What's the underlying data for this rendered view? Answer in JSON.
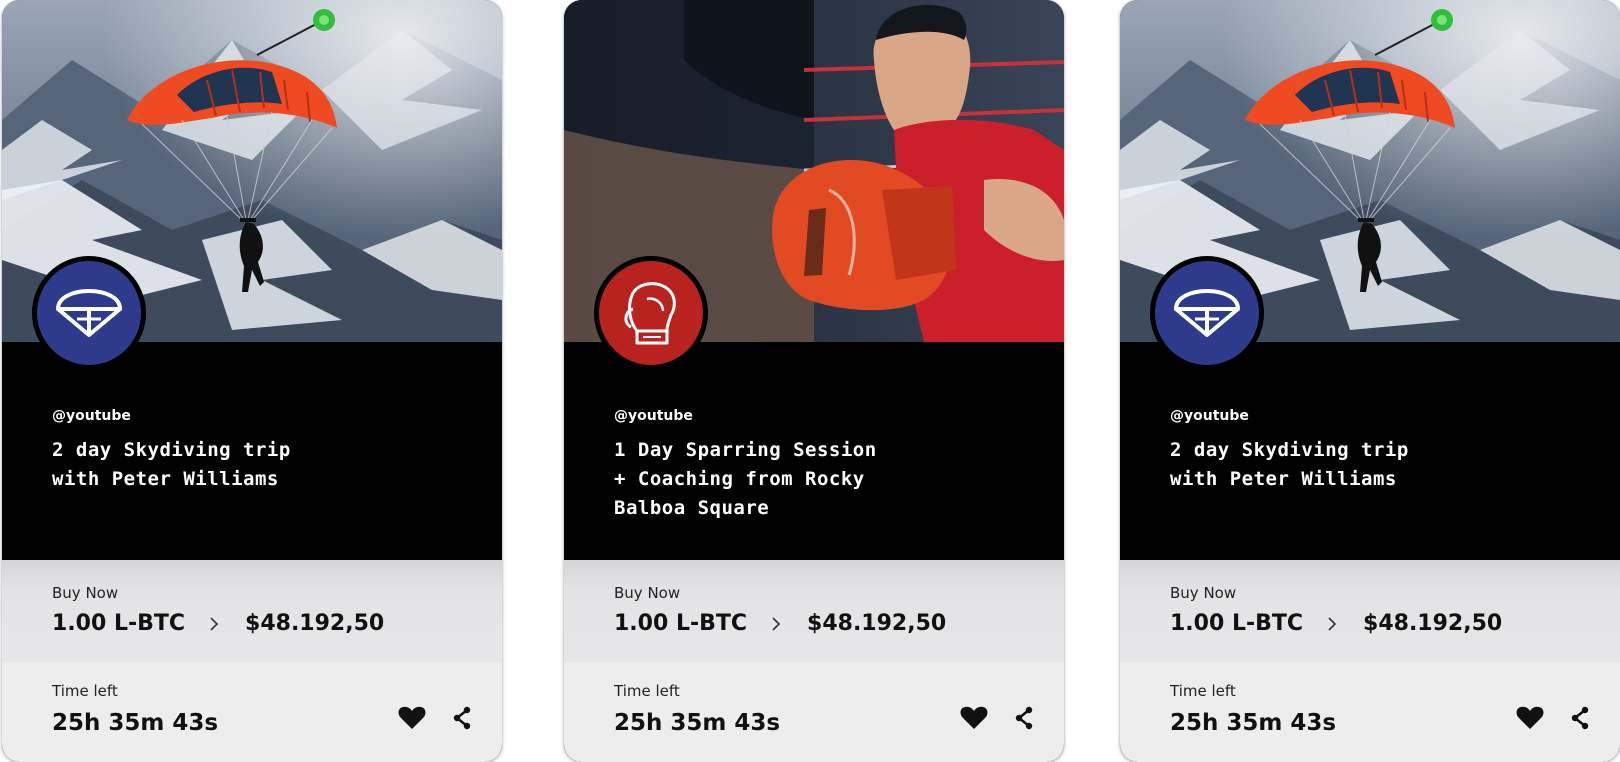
{
  "cards": [
    {
      "scene": "skydiving",
      "badge_color": "#2e3a8c",
      "badge_icon": "parachute-icon",
      "handle": "@youtube",
      "title_lines": [
        "2 day Skydiving trip",
        "with Peter Williams",
        ""
      ],
      "buy_label": "Buy Now",
      "crypto_price": "1.00 L-BTC",
      "fiat_price": "$48.192,50",
      "time_label": "Time left",
      "time_left": "25h 35m 43s"
    },
    {
      "scene": "boxing",
      "badge_color": "#b8221f",
      "badge_icon": "boxing-glove-icon",
      "handle": "@youtube",
      "title_lines": [
        "1 Day Sparring Session",
        "+ Coaching from Rocky",
        "Balboa Square"
      ],
      "buy_label": "Buy Now",
      "crypto_price": "1.00 L-BTC",
      "fiat_price": "$48.192,50",
      "time_label": "Time left",
      "time_left": "25h 35m 43s"
    },
    {
      "scene": "skydiving",
      "badge_color": "#2e3a8c",
      "badge_icon": "parachute-icon",
      "handle": "@youtube",
      "title_lines": [
        "2 day Skydiving trip",
        "with Peter Williams",
        ""
      ],
      "buy_label": "Buy Now",
      "crypto_price": "1.00 L-BTC",
      "fiat_price": "$48.192,50",
      "time_label": "Time left",
      "time_left": "25h 35m 43s"
    }
  ]
}
